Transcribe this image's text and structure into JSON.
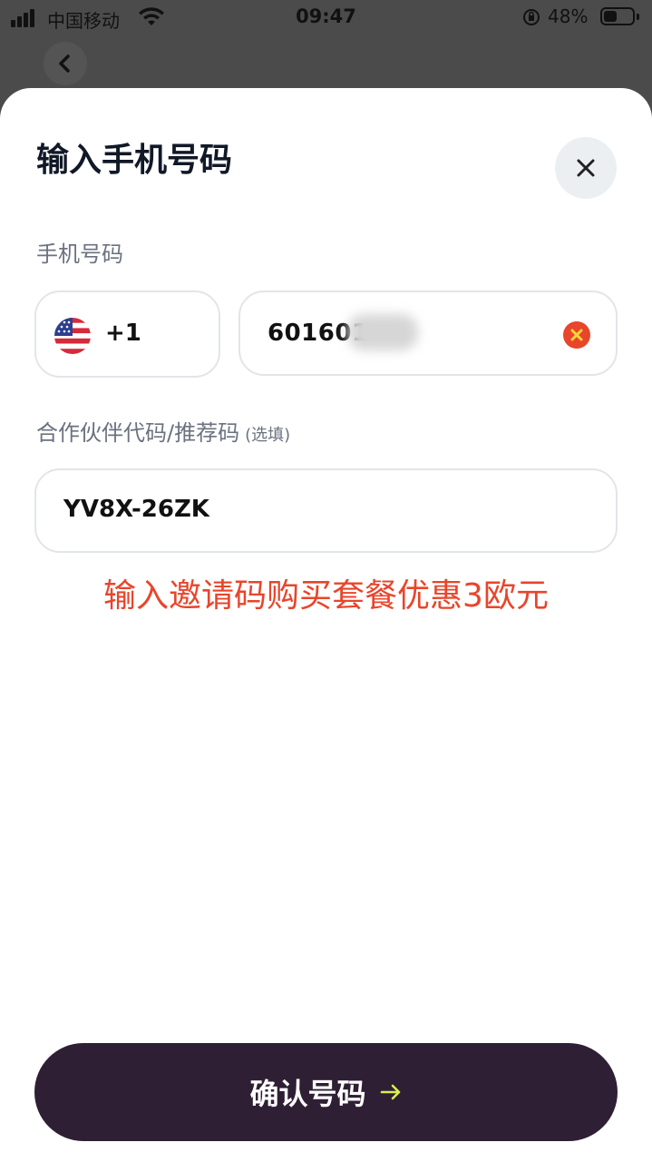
{
  "status": {
    "carrier": "中国移动",
    "time": "09:47",
    "battery_percent": "48%",
    "battery_level": 0.48
  },
  "sheet": {
    "title": "输入手机号码",
    "phone_label": "手机号码",
    "country_code": "+1",
    "country_flag": "us-flag-icon",
    "phone_value": "601601",
    "invite_label": "合作伙伴代码/推荐码",
    "invite_optional": "(选填)",
    "invite_value": "YV8X-26ZK",
    "promo_text": "输入邀请码购买套餐优惠3欧元",
    "confirm_label": "确认号码"
  },
  "colors": {
    "accent": "#2f1f34",
    "promo": "#e8452b",
    "clear": "#e8452b",
    "arrow": "#d8f04a"
  }
}
